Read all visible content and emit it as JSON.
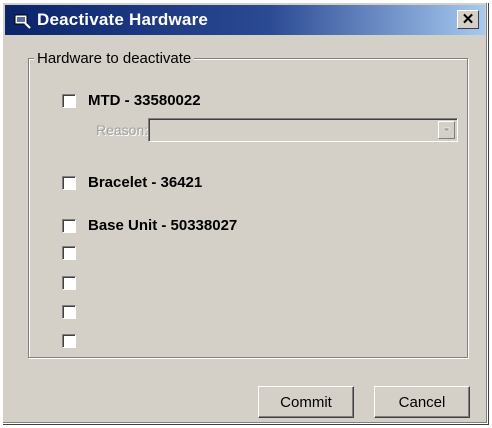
{
  "window": {
    "title": "Deactivate Hardware",
    "title_icon": "hardware-icon",
    "close_glyph": "✕"
  },
  "group": {
    "legend": "Hardware to deactivate"
  },
  "items": [
    {
      "label": "MTD - 33580022",
      "checked": false
    },
    {
      "label": "Bracelet - 36421",
      "checked": false
    },
    {
      "label": "Base Unit - 50338027",
      "checked": false
    },
    {
      "label": "",
      "checked": false
    },
    {
      "label": "",
      "checked": false
    },
    {
      "label": "",
      "checked": false
    },
    {
      "label": "",
      "checked": false
    }
  ],
  "reason": {
    "label": "Reason:",
    "value": "",
    "enabled": false
  },
  "buttons": {
    "commit_label": "Commit",
    "cancel_label": "Cancel"
  },
  "colors": {
    "title_start": "#0a246a",
    "title_end": "#a6caf0",
    "face": "#d4d0c8"
  }
}
